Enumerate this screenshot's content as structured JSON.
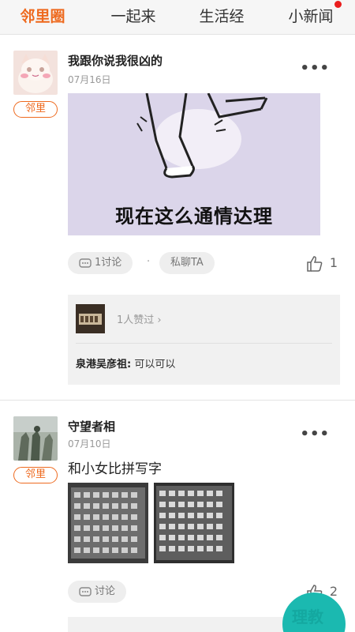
{
  "tabs": [
    {
      "label": "邻里圈",
      "active": true
    },
    {
      "label": "一起来",
      "active": false
    },
    {
      "label": "生活经",
      "active": false
    },
    {
      "label": "小新闻",
      "active": false,
      "has_notification": true
    }
  ],
  "accent_color": "#ee6a1f",
  "posts": [
    {
      "author": "我跟你说我很凶的",
      "date": "07月16日",
      "badge": "邻里",
      "image_caption": "现在这么通情达理",
      "comment_pill": "1讨论",
      "message_pill": "私聊TA",
      "like_count": "1",
      "likes_summary": "1人赞过",
      "comment": {
        "name": "泉港吴彦祖:",
        "text": "可以可以"
      }
    },
    {
      "author": "守望者相",
      "date": "07月10日",
      "badge": "邻里",
      "text": "和小女比拼写字",
      "comment_pill": "讨论",
      "like_count": "2"
    }
  ],
  "watermark_text": "理教"
}
